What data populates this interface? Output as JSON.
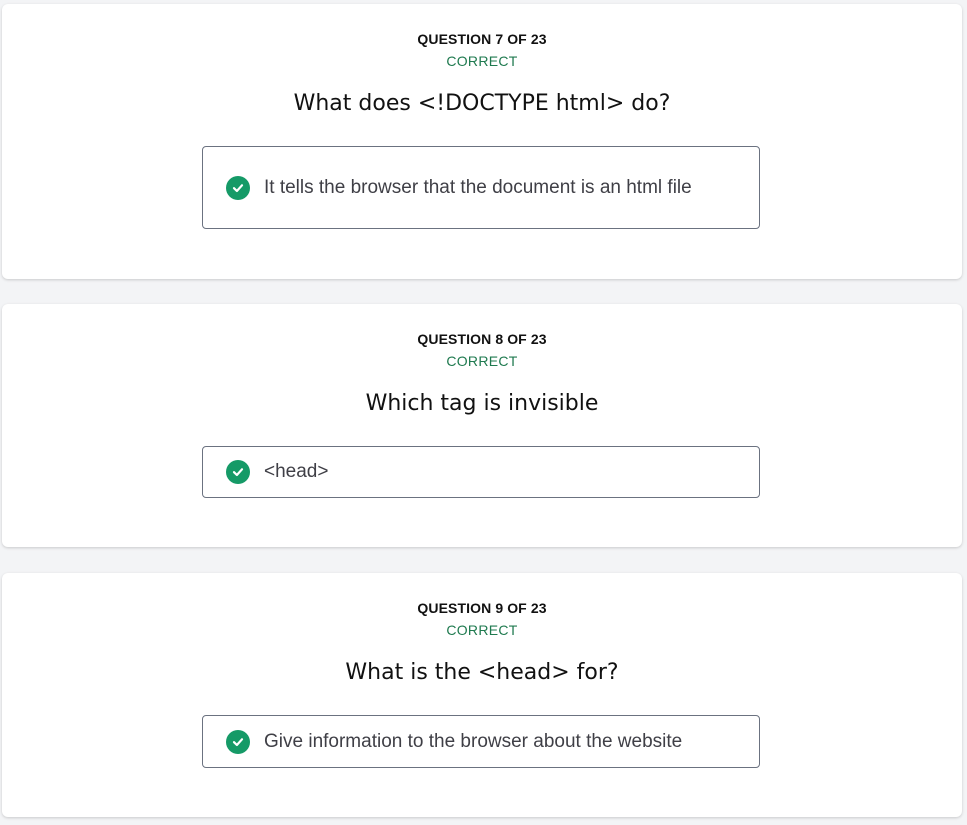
{
  "colors": {
    "background": "#f3f4f6",
    "card": "#ffffff",
    "correct_text": "#1f7a4f",
    "check_fill": "#159a67",
    "answer_border": "#6b7280"
  },
  "questions": [
    {
      "number_label": "QUESTION 7 OF 23",
      "status": "CORRECT",
      "question": "What does <!DOCTYPE html> do?",
      "answer": "It tells the browser that the document is an html file",
      "icon": "check-circle-icon"
    },
    {
      "number_label": "QUESTION 8 OF 23",
      "status": "CORRECT",
      "question": "Which tag is invisible",
      "answer": "<head>",
      "icon": "check-circle-icon"
    },
    {
      "number_label": "QUESTION 9 OF 23",
      "status": "CORRECT",
      "question": "What is the <head> for?",
      "answer": "Give information to the browser about the website",
      "icon": "check-circle-icon"
    }
  ]
}
